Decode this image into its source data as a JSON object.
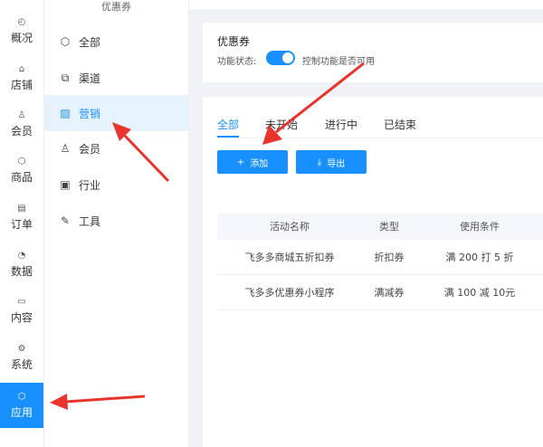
{
  "rail": {
    "items": [
      {
        "label": "概况",
        "icon": "dashboard-icon"
      },
      {
        "label": "店铺",
        "icon": "store-icon"
      },
      {
        "label": "会员",
        "icon": "user-icon"
      },
      {
        "label": "商品",
        "icon": "box-icon"
      },
      {
        "label": "订单",
        "icon": "order-icon"
      },
      {
        "label": "数据",
        "icon": "chart-icon"
      },
      {
        "label": "内容",
        "icon": "folder-icon"
      },
      {
        "label": "系统",
        "icon": "settings-icon"
      },
      {
        "label": "应用",
        "icon": "app-icon"
      }
    ],
    "active_index": 8,
    "active_color": "#1890ff"
  },
  "submenu": {
    "title": "优惠券",
    "items": [
      {
        "label": "全部",
        "icon": "cube-icon"
      },
      {
        "label": "渠道",
        "icon": "channel-icon"
      },
      {
        "label": "营销",
        "icon": "marketing-icon"
      },
      {
        "label": "会员",
        "icon": "member-icon"
      },
      {
        "label": "行业",
        "icon": "industry-icon"
      },
      {
        "label": "工具",
        "icon": "tool-icon"
      }
    ],
    "active_index": 2
  },
  "coupon": {
    "title": "优惠券",
    "status_label": "功能状态:",
    "toggle_on": true,
    "toggle_desc": "控制功能是否可用"
  },
  "tabs": [
    "全部",
    "未开始",
    "进行中",
    "已结束"
  ],
  "active_tab": 0,
  "buttons": {
    "add": "添加",
    "export": "导出"
  },
  "table": {
    "headers": [
      "活动名称",
      "类型",
      "使用条件"
    ],
    "rows": [
      [
        "飞多多商城五折扣券",
        "折扣券",
        "满 200 打 5 折"
      ],
      [
        "飞多多优惠券小程序",
        "满减券",
        "满 100 减 10元"
      ]
    ]
  },
  "colors": {
    "accent": "#1890ff",
    "annotation_arrow": "#e8342c"
  }
}
